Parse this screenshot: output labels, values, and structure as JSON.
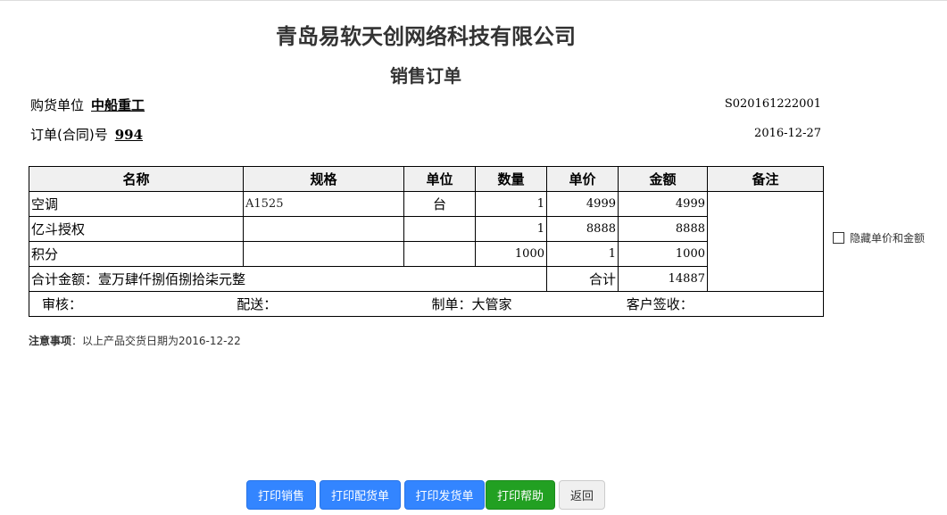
{
  "company": "青岛易软天创网络科技有限公司",
  "title": "销售订单",
  "buyer": {
    "label": "购货单位",
    "value": "中船重工"
  },
  "order": {
    "label": "订单(合同)号",
    "value": "994"
  },
  "order_code": "S020161222001",
  "date": "2016-12-27",
  "table": {
    "headers": [
      "名称",
      "规格",
      "单位",
      "数量",
      "单价",
      "金额",
      "备注"
    ],
    "rows": [
      {
        "name": "空调",
        "spec": "A1525",
        "unit": "台",
        "qty": "1",
        "price": "4999",
        "amount": "4999"
      },
      {
        "name": "亿斗授权",
        "spec": "",
        "unit": "",
        "qty": "1",
        "price": "8888",
        "amount": "8888"
      },
      {
        "name": "积分",
        "spec": "",
        "unit": "",
        "qty": "1000",
        "price": "1",
        "amount": "1000"
      }
    ],
    "total_words": "合计金额：壹万肆仟捌佰捌拾柒元整",
    "total_label": "合计",
    "total": "14887",
    "signatures": [
      "审核：",
      "配送：",
      "制单：大管家",
      "客户签收："
    ]
  },
  "note": {
    "label": "注意事项",
    "text": "：以上产品交货日期为2016-12-22"
  },
  "hide_checkbox": {
    "label": "隐藏单价和金额",
    "checked": false
  },
  "buttons": [
    "打印销售",
    "打印配货单",
    "打印发货单",
    "打印帮助",
    "返回"
  ]
}
